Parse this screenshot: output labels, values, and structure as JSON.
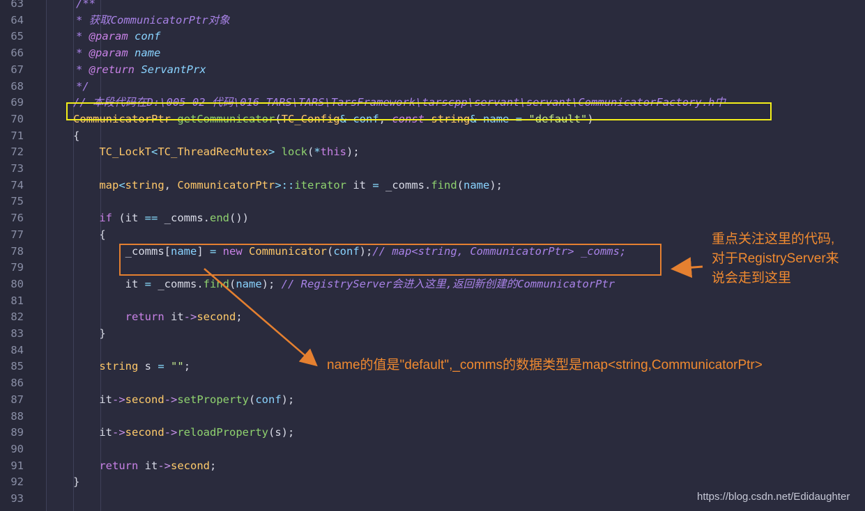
{
  "lines": [
    {
      "n": "63",
      "t": " /**"
    },
    {
      "n": "64",
      "t": " * 获取CommunicatorPtr对象"
    },
    {
      "n": "65",
      "t": " * @param conf"
    },
    {
      "n": "66",
      "t": " * @param name"
    },
    {
      "n": "67",
      "t": " * @return ServantPrx"
    },
    {
      "n": "68",
      "t": " */"
    },
    {
      "n": "69",
      "t": "// 本段代码在D:\\005-02-代码\\016-TARS\\TARS\\TarsFramework\\tarscpp\\servant\\servant\\CommunicatorFactory.h中"
    },
    {
      "n": "70",
      "t": "CommunicatorPtr getCommunicator(TC_Config& conf, const string& name = \"default\")"
    },
    {
      "n": "71",
      "t": "{"
    },
    {
      "n": "72",
      "t": "    TC_LockT<TC_ThreadRecMutex> lock(*this);"
    },
    {
      "n": "73",
      "t": ""
    },
    {
      "n": "74",
      "t": "    map<string, CommunicatorPtr>::iterator it = _comms.find(name);"
    },
    {
      "n": "75",
      "t": ""
    },
    {
      "n": "76",
      "t": "    if (it == _comms.end())"
    },
    {
      "n": "77",
      "t": "    {"
    },
    {
      "n": "78",
      "t": "        _comms[name] = new Communicator(conf);// map<string, CommunicatorPtr> _comms;"
    },
    {
      "n": "79",
      "t": ""
    },
    {
      "n": "80",
      "t": "        it = _comms.find(name); // RegistryServer会进入这里,返回新创建的CommunicatorPtr"
    },
    {
      "n": "81",
      "t": ""
    },
    {
      "n": "82",
      "t": "        return it->second;"
    },
    {
      "n": "83",
      "t": "    }"
    },
    {
      "n": "84",
      "t": ""
    },
    {
      "n": "85",
      "t": "    string s = \"\";"
    },
    {
      "n": "86",
      "t": ""
    },
    {
      "n": "87",
      "t": "    it->second->setProperty(conf);"
    },
    {
      "n": "88",
      "t": ""
    },
    {
      "n": "89",
      "t": "    it->second->reloadProperty(s);"
    },
    {
      "n": "90",
      "t": ""
    },
    {
      "n": "91",
      "t": "    return it->second;"
    },
    {
      "n": "92",
      "t": "}"
    },
    {
      "n": "93",
      "t": ""
    }
  ],
  "annotations": {
    "right_note_lines": [
      "重点关注这里的代码,",
      "对于RegistryServer来",
      "说会走到这里"
    ],
    "bottom_note": "name的值是\"default\",_comms的数据类型是map<string,CommunicatorPtr>"
  },
  "watermark": "https://blog.csdn.net/Edidaughter",
  "colors": {
    "background": "#2a2b3d",
    "highlight_yellow": "#f4ef1a",
    "highlight_orange": "#e58030",
    "annotation_text": "#f08a30"
  }
}
